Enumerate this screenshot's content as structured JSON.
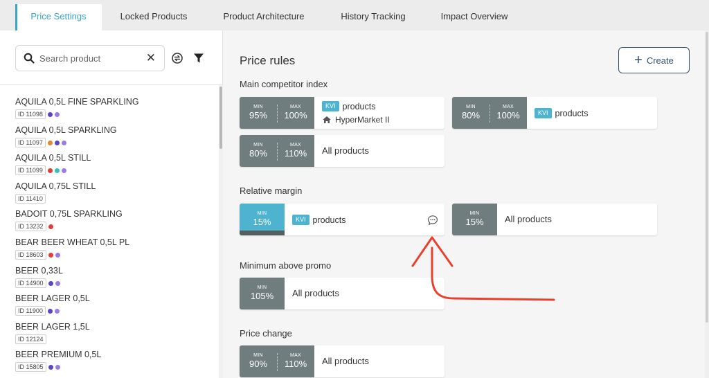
{
  "tabs": [
    {
      "label": "Price Settings",
      "active": true
    },
    {
      "label": "Locked Products"
    },
    {
      "label": "Product Architecture"
    },
    {
      "label": "History Tracking"
    },
    {
      "label": "Impact Overview"
    }
  ],
  "sidebar": {
    "search": {
      "placeholder": "Search product",
      "value": "",
      "clear_icon": "close-icon",
      "icon": "search-icon"
    },
    "sync_icon": "sync-icon",
    "filter_icon": "filter-icon",
    "products": [
      {
        "name": "AQUILA 0,5L FINE SPARKLING",
        "id": "ID 11098",
        "dots": [
          "#5b45c7",
          "#9b79e8"
        ]
      },
      {
        "name": "AQUILA 0,5L SPARKLING",
        "id": "ID 11097",
        "dots": [
          "#e8862c",
          "#5b45c7",
          "#9b79e8"
        ]
      },
      {
        "name": "AQUILA 0,5L STILL",
        "id": "ID 11099",
        "dots": [
          "#e23c3c",
          "#35c2b4",
          "#9b79e8"
        ]
      },
      {
        "name": "AQUILA 0,75L STILL",
        "id": "ID 11410",
        "dots": []
      },
      {
        "name": "BADOIT 0,75L SPARKLING",
        "id": "ID 13232",
        "dots": [
          "#e23c3c"
        ]
      },
      {
        "name": "BEAR BEER WHEAT 0,5L PL",
        "id": "ID 18603",
        "dots": [
          "#e23c3c",
          "#9b79e8"
        ]
      },
      {
        "name": "BEER 0,33L",
        "id": "ID 14900",
        "dots": [
          "#5b45c7",
          "#9b79e8"
        ]
      },
      {
        "name": "BEER LAGER 0,5L",
        "id": "ID 11900",
        "dots": [
          "#5b45c7",
          "#9b79e8"
        ]
      },
      {
        "name": "BEER LAGER 1,5L",
        "id": "ID 12124",
        "dots": []
      },
      {
        "name": "BEER PREMIUM 0,5L",
        "id": "ID 15805",
        "dots": [
          "#5b45c7",
          "#9b79e8"
        ]
      }
    ]
  },
  "main": {
    "title": "Price rules",
    "create_label": "Create",
    "sections": {
      "competitor": "Main competitor index",
      "margin": "Relative margin",
      "promo": "Minimum above promo",
      "change": "Price change"
    },
    "labels": {
      "min": "MIN",
      "max": "MAX",
      "kvi": "KVI",
      "products": "products",
      "all": "All products"
    },
    "rules": {
      "comp1": {
        "min": "95%",
        "max": "100%",
        "store": "HyperMarket II"
      },
      "comp2": {
        "min": "80%",
        "max": "100%"
      },
      "comp3": {
        "min": "80%",
        "max": "110%"
      },
      "margin1": {
        "min": "15%"
      },
      "margin2": {
        "min": "15%"
      },
      "promo1": {
        "min": "105%"
      },
      "change1": {
        "min": "90%",
        "max": "110%"
      }
    }
  },
  "colors": {
    "accent": "#4db3cf",
    "rule_gray": "#707d7e",
    "annotation_red": "#e8402c",
    "create_border": "#2f4f6c"
  }
}
